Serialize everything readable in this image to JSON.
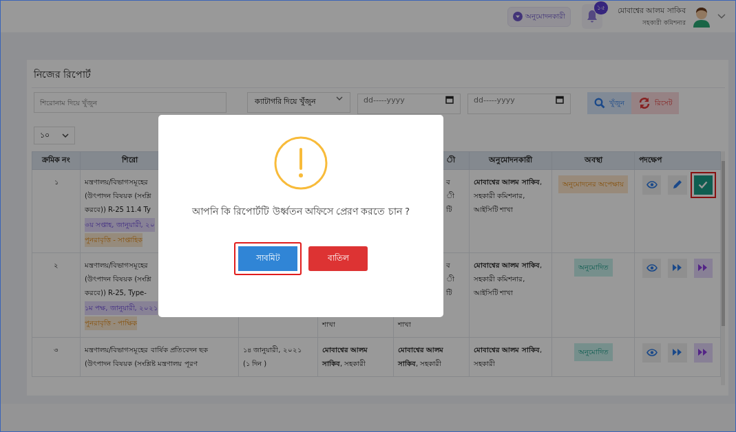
{
  "header": {
    "role_button": "অনুমোদনকারী",
    "notification_count": "১৫",
    "user_name": "মোবাশ্বের আলম সাকিব",
    "user_role": "সহকারী কমিশনার"
  },
  "card": {
    "title": "নিজের রিপোর্ট",
    "filters": {
      "search": {
        "placeholder": "শিরোনাম দিয়ে খুঁজুন"
      },
      "category": "ক্যাটাগরি দিয়ে খুঁজুন",
      "date_from": {
        "placeholder": "dd-----yyyy"
      },
      "date_to": {
        "placeholder": "dd-----yyyy"
      },
      "search_button": "খুঁজুন",
      "reset_button": "রিসেট"
    },
    "page_size": "১০",
    "table": {
      "header": {
        "serial": "ক্রমিক নং",
        "title": "শিরো",
        "column_5_fragment": "ী",
        "approver": "অনুমোদনকারী",
        "status": "অবস্থা",
        "actions": "পদক্ষেপ"
      },
      "rows": [
        {
          "serial": "১",
          "title_lines": [
            "মন্ত্রণালয়/বিভাগসমূহের",
            "(উৎপাদন বিষয়ক (সংশ্লি",
            "করবে)) R-25 11.4 Ty"
          ],
          "period": "৩য় সপ্তাহ, জানুয়ারী, ২০",
          "recurrence": "পুনরাবৃত্তি - সাপ্তাহিক",
          "column_5": {
            "fragments": [
              "ব",
              "ী",
              "টি"
            ]
          },
          "approver": "**মোবাশ্বের আলম সাকিব**, সহকারী কমিশনার, আইসিটি শাখা",
          "status": {
            "kind": "pending",
            "label": "অনুমোদনের অপেক্ষায়"
          },
          "actions": [
            {
              "kind": "view",
              "highlighted": false
            },
            {
              "kind": "edit",
              "highlighted": false
            },
            {
              "kind": "approve",
              "highlighted": true
            }
          ]
        },
        {
          "serial": "২",
          "title_lines": [
            "মন্ত্রণালয়/বিভাগসমূহের",
            "(উৎপাদন বিষয়ক (সংশ্লি",
            "করবে)) R-25, Type-"
          ],
          "period": "১ম পক্ষ, জানুয়ারী, ২০২১",
          "recurrence": "পুনরাবৃত্তি - পাক্ষিক",
          "column_4": {
            "tail": "শাখা"
          },
          "column_5": {
            "fragments": [
              "ব",
              "ী",
              "টি"
            ],
            "tail": "শাখা"
          },
          "approver": "**মোবাশ্বের আলম সাকিব**, সহকারী কমিশনার, আইসিটি শাখা",
          "status": {
            "kind": "approved",
            "label": "অনুমোদিত"
          },
          "actions": [
            {
              "kind": "view",
              "highlighted": false
            },
            {
              "kind": "forward",
              "highlighted": false
            },
            {
              "kind": "forward_all",
              "highlighted": false
            }
          ]
        },
        {
          "serial": "৩",
          "title_lines": [
            "মন্ত্রণালয়/বিভাগসমূহের বার্ষিক প্রতিবেদন ছক",
            "(উৎপাদন বিষয়ক (সংশ্লিষ্ট মন্ত্রণালয় পূরণ"
          ],
          "date": "১৪ জানুয়ারী, ২০২১",
          "duration": "(১ দিন )",
          "column_4": {
            "text": "**মোবাশ্বের আলম সাকিব**, সহকারী"
          },
          "column_5": {
            "text": "**মোবাশ্বের আলম সাকিব**, সহকারী"
          },
          "approver": "**মোবাশ্বের আলম সাকিব**, সহকারী",
          "status": {
            "kind": "approved",
            "label": "অনুমোদিত"
          },
          "actions": [
            {
              "kind": "view",
              "highlighted": false
            },
            {
              "kind": "forward",
              "highlighted": false
            },
            {
              "kind": "forward_all",
              "highlighted": false
            }
          ]
        }
      ]
    }
  },
  "dialog": {
    "message": "আপনি কি রিপোর্টটি উর্ধ্বতন অফিসে প্রেরণ করতে চান ?",
    "confirm_button": {
      "label": "সাবমিট",
      "highlighted": true
    },
    "cancel_button": "বাতিল"
  }
}
